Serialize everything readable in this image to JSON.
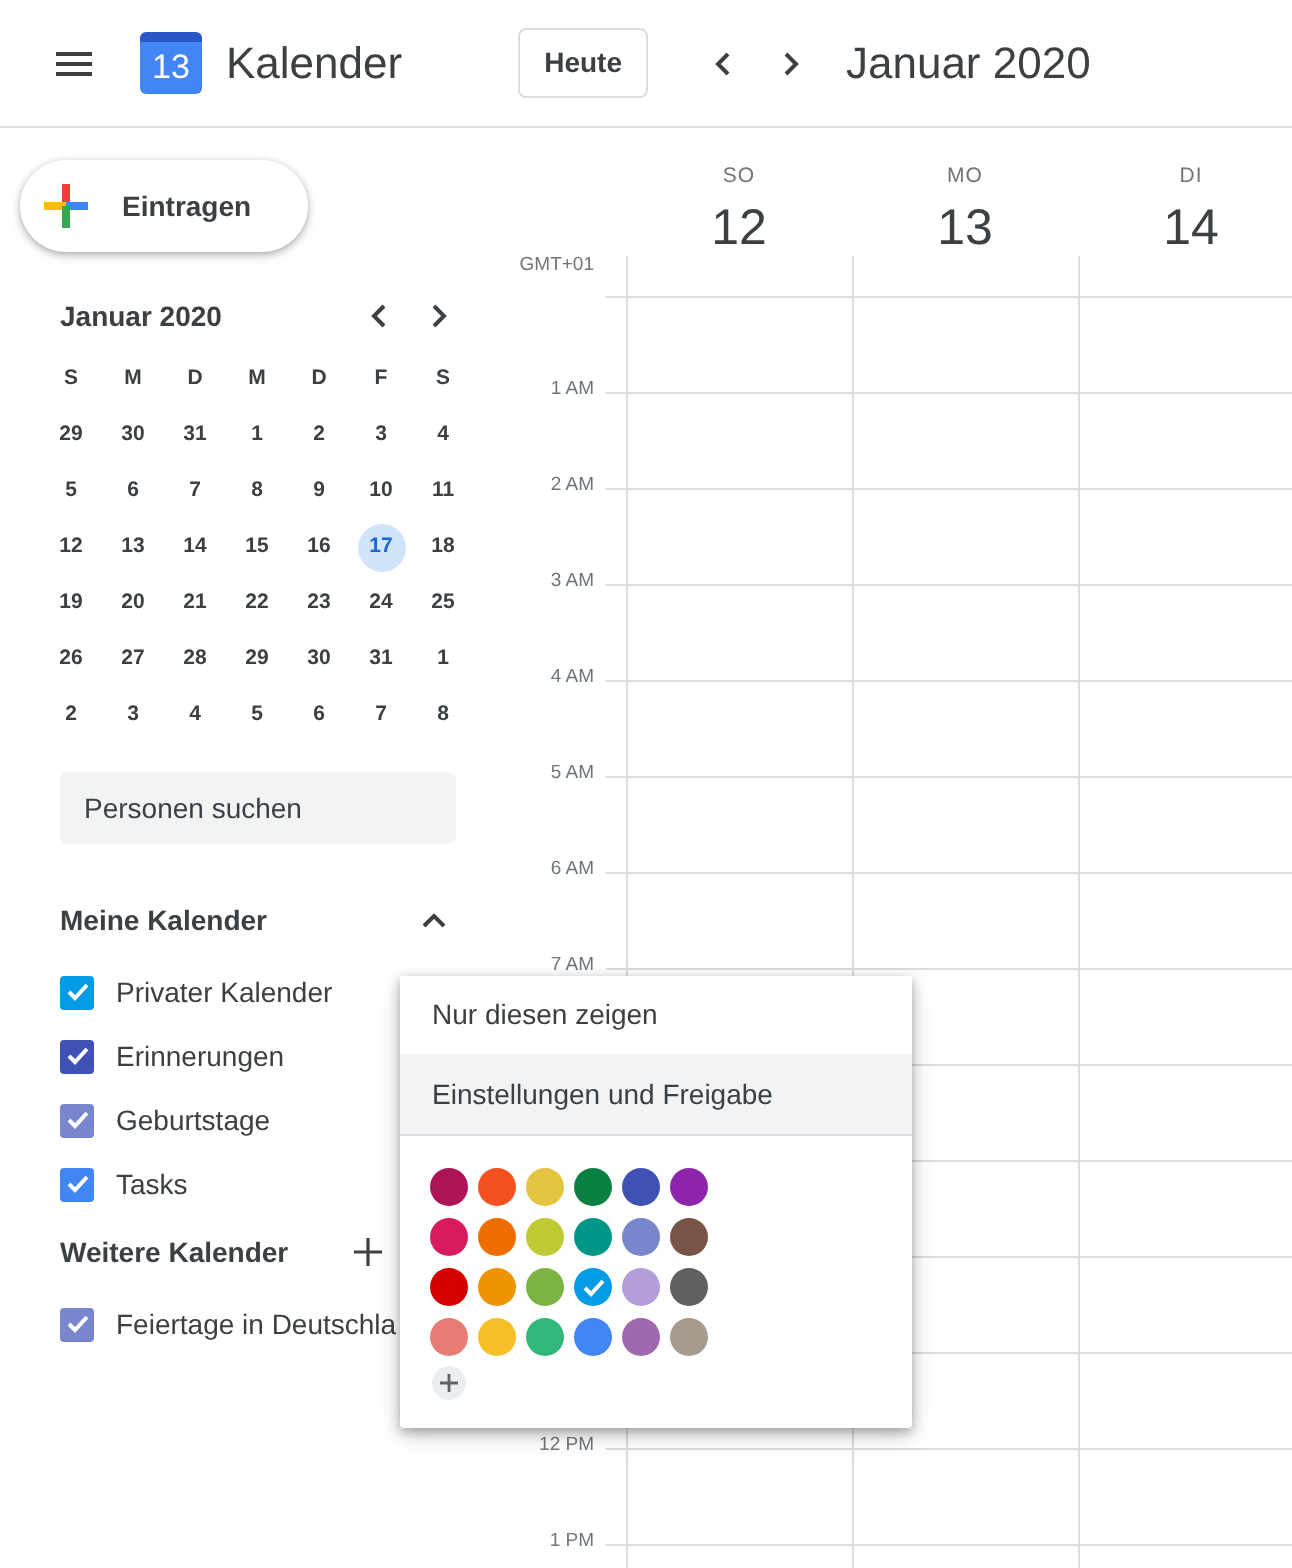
{
  "header": {
    "logo_day": "13",
    "title": "Kalender",
    "today_button": "Heute",
    "period": "Januar 2020"
  },
  "create_button": "Eintragen",
  "mini_calendar": {
    "title": "Januar 2020",
    "weekdays": [
      "S",
      "M",
      "D",
      "M",
      "D",
      "F",
      "S"
    ],
    "weeks": [
      [
        {
          "day": "29",
          "selected": false
        },
        {
          "day": "30",
          "selected": false
        },
        {
          "day": "31",
          "selected": false
        },
        {
          "day": "1",
          "selected": false
        },
        {
          "day": "2",
          "selected": false
        },
        {
          "day": "3",
          "selected": false
        },
        {
          "day": "4",
          "selected": false
        }
      ],
      [
        {
          "day": "5",
          "selected": false
        },
        {
          "day": "6",
          "selected": false
        },
        {
          "day": "7",
          "selected": false
        },
        {
          "day": "8",
          "selected": false
        },
        {
          "day": "9",
          "selected": false
        },
        {
          "day": "10",
          "selected": false
        },
        {
          "day": "11",
          "selected": false
        }
      ],
      [
        {
          "day": "12",
          "selected": false
        },
        {
          "day": "13",
          "selected": false
        },
        {
          "day": "14",
          "selected": false
        },
        {
          "day": "15",
          "selected": false
        },
        {
          "day": "16",
          "selected": false
        },
        {
          "day": "17",
          "selected": true
        },
        {
          "day": "18",
          "selected": false
        }
      ],
      [
        {
          "day": "19",
          "selected": false
        },
        {
          "day": "20",
          "selected": false
        },
        {
          "day": "21",
          "selected": false
        },
        {
          "day": "22",
          "selected": false
        },
        {
          "day": "23",
          "selected": false
        },
        {
          "day": "24",
          "selected": false
        },
        {
          "day": "25",
          "selected": false
        }
      ],
      [
        {
          "day": "26",
          "selected": false
        },
        {
          "day": "27",
          "selected": false
        },
        {
          "day": "28",
          "selected": false
        },
        {
          "day": "29",
          "selected": false
        },
        {
          "day": "30",
          "selected": false
        },
        {
          "day": "31",
          "selected": false
        },
        {
          "day": "1",
          "selected": false
        }
      ],
      [
        {
          "day": "2",
          "selected": false
        },
        {
          "day": "3",
          "selected": false
        },
        {
          "day": "4",
          "selected": false
        },
        {
          "day": "5",
          "selected": false
        },
        {
          "day": "6",
          "selected": false
        },
        {
          "day": "7",
          "selected": false
        },
        {
          "day": "8",
          "selected": false
        }
      ]
    ]
  },
  "people_search": {
    "placeholder": "Personen suchen"
  },
  "my_calendars": {
    "title": "Meine Kalender",
    "expanded": true,
    "items": [
      {
        "name": "Privater Kalender",
        "checked": true,
        "color": "#039be5"
      },
      {
        "name": "Erinnerungen",
        "checked": true,
        "color": "#3f51b5"
      },
      {
        "name": "Geburtstage",
        "checked": true,
        "color": "#7986cb"
      },
      {
        "name": "Tasks",
        "checked": true,
        "color": "#4285f4"
      }
    ]
  },
  "other_calendars": {
    "title": "Weitere Kalender",
    "items": [
      {
        "name": "Feiertage in Deutschla",
        "checked": true,
        "color": "#7986cb"
      }
    ]
  },
  "week_view": {
    "timezone": "GMT+01",
    "days": [
      {
        "weekday": "SO",
        "date": "12"
      },
      {
        "weekday": "MO",
        "date": "13"
      },
      {
        "weekday": "DI",
        "date": "14"
      }
    ],
    "morning_hours": [
      "1 AM",
      "2 AM",
      "3 AM",
      "4 AM",
      "5 AM",
      "6 AM",
      "7 AM"
    ],
    "afternoon_hours": [
      "12 PM",
      "1 PM"
    ]
  },
  "context_menu": {
    "items": [
      {
        "label": "Nur diesen zeigen",
        "highlighted": false
      },
      {
        "label": "Einstellungen und Freigabe",
        "highlighted": true
      }
    ],
    "colors": [
      {
        "color": "#ad1457",
        "selected": false
      },
      {
        "color": "#f4511e",
        "selected": false
      },
      {
        "color": "#e4c441",
        "selected": false
      },
      {
        "color": "#0b8043",
        "selected": false
      },
      {
        "color": "#3f51b5",
        "selected": false
      },
      {
        "color": "#8e24aa",
        "selected": false
      },
      {
        "color": "#d81b60",
        "selected": false
      },
      {
        "color": "#ef6c00",
        "selected": false
      },
      {
        "color": "#c0ca33",
        "selected": false
      },
      {
        "color": "#009688",
        "selected": false
      },
      {
        "color": "#7986cb",
        "selected": false
      },
      {
        "color": "#795548",
        "selected": false
      },
      {
        "color": "#d50000",
        "selected": false
      },
      {
        "color": "#f09300",
        "selected": false
      },
      {
        "color": "#7cb342",
        "selected": false
      },
      {
        "color": "#039be5",
        "selected": true
      },
      {
        "color": "#b39ddb",
        "selected": false
      },
      {
        "color": "#616161",
        "selected": false
      },
      {
        "color": "#e67c73",
        "selected": false
      },
      {
        "color": "#f6bf26",
        "selected": false
      },
      {
        "color": "#33b679",
        "selected": false
      },
      {
        "color": "#4285f4",
        "selected": false
      },
      {
        "color": "#9e69af",
        "selected": false
      },
      {
        "color": "#a79b8e",
        "selected": false
      }
    ]
  }
}
